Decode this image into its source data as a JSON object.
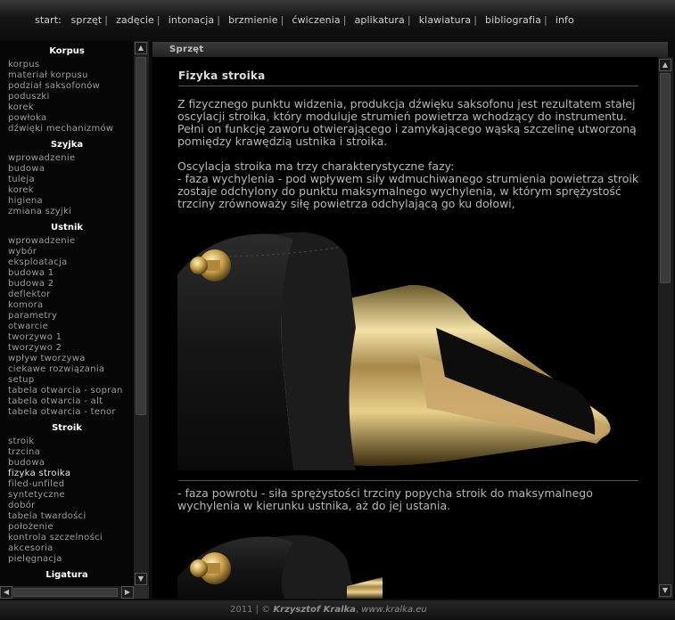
{
  "nav": {
    "start": "start:",
    "items": [
      "sprzęt",
      "zadęcie",
      "intonacja",
      "brzmienie",
      "ćwiczenia",
      "aplikatura",
      "klawiatura",
      "bibliografia",
      "info"
    ],
    "separator": "|"
  },
  "sidebar": {
    "sections": [
      {
        "heading": "Korpus",
        "items": [
          "korpus",
          "materiał korpusu",
          "podział saksofonów",
          "poduszki",
          "korek",
          "powłoka",
          "dźwięki mechanizmów"
        ]
      },
      {
        "heading": "Szyjka",
        "items": [
          "wprowadzenie",
          "budowa",
          "tuleja",
          "korek",
          "higiena",
          "zmiana szyjki"
        ]
      },
      {
        "heading": "Ustnik",
        "items": [
          "wprowadzenie",
          "wybór",
          "eksploatacja",
          "budowa 1",
          "budowa 2",
          "deflektor",
          "komora",
          "parametry",
          "otwarcie",
          "tworzywo 1",
          "tworzywo 2",
          "wpływ tworzywa",
          "ciekawe rozwiązania",
          "setup",
          "tabela otwarcia - sopran",
          "tabela otwarcia - alt",
          "tabela otwarcia - tenor"
        ]
      },
      {
        "heading": "Stroik",
        "items": [
          "stroik",
          "trzcina",
          "budowa",
          "fizyka stroika",
          "filed-unfiled",
          "syntetyczne",
          "dobór",
          "tabela twardości",
          "położenie",
          "kontrola szczelności",
          "akcesoria",
          "pielęgnacja"
        ]
      },
      {
        "heading": "Ligatura",
        "items": []
      }
    ],
    "active": "fizyka stroika"
  },
  "breadcrumb": "Sprzęt",
  "content": {
    "title": "Fizyka stroika",
    "para1": "Z fizycznego punktu widzenia, produkcja dźwięku saksofonu jest rezultatem stałej oscylacji stroika, który moduluje strumień powietrza wchodzący do instrumentu. Pełni on funkcję zaworu otwierającego i zamykającego wąską szczelinę utworzoną pomiędzy krawędzią ustnika i stroika.",
    "para2": "Oscylacja stroika ma trzy charakterystyczne fazy:",
    "para3": "- faza wychylenia - pod wpływem siły wdmuchiwanego strumienia powietrza stroik zostaje odchylony do punktu maksymalnego wychylenia, w którym sprężystość trzciny zrównoważy siłę powietrza odchylającą go ku dołowi,",
    "para4": "- faza powrotu - siła sprężystości trzciny popycha stroik do maksymalnego wychylenia w kierunku ustnika, aż do jej ustania."
  },
  "footer": {
    "year": "2011",
    "sep": "|",
    "copy": "©",
    "author": "Krzysztof Kralka",
    "comma": ",",
    "url": "www.kralka.eu"
  },
  "colors": {
    "background": "#000000",
    "nav_text": "#d0d0d0",
    "sidebar_heading": "#ffffff",
    "sidebar_link": "#9d9d9d",
    "content_text": "#b7b7b7",
    "gold": "#c9a24a"
  }
}
